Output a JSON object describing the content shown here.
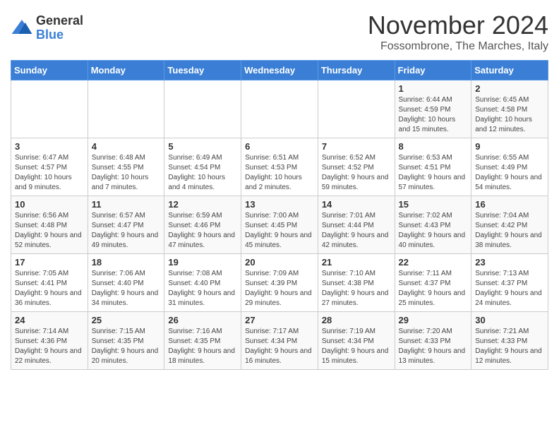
{
  "logo": {
    "general": "General",
    "blue": "Blue"
  },
  "title": "November 2024",
  "location": "Fossombrone, The Marches, Italy",
  "headers": [
    "Sunday",
    "Monday",
    "Tuesday",
    "Wednesday",
    "Thursday",
    "Friday",
    "Saturday"
  ],
  "rows": [
    [
      {
        "day": "",
        "info": ""
      },
      {
        "day": "",
        "info": ""
      },
      {
        "day": "",
        "info": ""
      },
      {
        "day": "",
        "info": ""
      },
      {
        "day": "",
        "info": ""
      },
      {
        "day": "1",
        "info": "Sunrise: 6:44 AM\nSunset: 4:59 PM\nDaylight: 10 hours and 15 minutes."
      },
      {
        "day": "2",
        "info": "Sunrise: 6:45 AM\nSunset: 4:58 PM\nDaylight: 10 hours and 12 minutes."
      }
    ],
    [
      {
        "day": "3",
        "info": "Sunrise: 6:47 AM\nSunset: 4:57 PM\nDaylight: 10 hours and 9 minutes."
      },
      {
        "day": "4",
        "info": "Sunrise: 6:48 AM\nSunset: 4:55 PM\nDaylight: 10 hours and 7 minutes."
      },
      {
        "day": "5",
        "info": "Sunrise: 6:49 AM\nSunset: 4:54 PM\nDaylight: 10 hours and 4 minutes."
      },
      {
        "day": "6",
        "info": "Sunrise: 6:51 AM\nSunset: 4:53 PM\nDaylight: 10 hours and 2 minutes."
      },
      {
        "day": "7",
        "info": "Sunrise: 6:52 AM\nSunset: 4:52 PM\nDaylight: 9 hours and 59 minutes."
      },
      {
        "day": "8",
        "info": "Sunrise: 6:53 AM\nSunset: 4:51 PM\nDaylight: 9 hours and 57 minutes."
      },
      {
        "day": "9",
        "info": "Sunrise: 6:55 AM\nSunset: 4:49 PM\nDaylight: 9 hours and 54 minutes."
      }
    ],
    [
      {
        "day": "10",
        "info": "Sunrise: 6:56 AM\nSunset: 4:48 PM\nDaylight: 9 hours and 52 minutes."
      },
      {
        "day": "11",
        "info": "Sunrise: 6:57 AM\nSunset: 4:47 PM\nDaylight: 9 hours and 49 minutes."
      },
      {
        "day": "12",
        "info": "Sunrise: 6:59 AM\nSunset: 4:46 PM\nDaylight: 9 hours and 47 minutes."
      },
      {
        "day": "13",
        "info": "Sunrise: 7:00 AM\nSunset: 4:45 PM\nDaylight: 9 hours and 45 minutes."
      },
      {
        "day": "14",
        "info": "Sunrise: 7:01 AM\nSunset: 4:44 PM\nDaylight: 9 hours and 42 minutes."
      },
      {
        "day": "15",
        "info": "Sunrise: 7:02 AM\nSunset: 4:43 PM\nDaylight: 9 hours and 40 minutes."
      },
      {
        "day": "16",
        "info": "Sunrise: 7:04 AM\nSunset: 4:42 PM\nDaylight: 9 hours and 38 minutes."
      }
    ],
    [
      {
        "day": "17",
        "info": "Sunrise: 7:05 AM\nSunset: 4:41 PM\nDaylight: 9 hours and 36 minutes."
      },
      {
        "day": "18",
        "info": "Sunrise: 7:06 AM\nSunset: 4:40 PM\nDaylight: 9 hours and 34 minutes."
      },
      {
        "day": "19",
        "info": "Sunrise: 7:08 AM\nSunset: 4:40 PM\nDaylight: 9 hours and 31 minutes."
      },
      {
        "day": "20",
        "info": "Sunrise: 7:09 AM\nSunset: 4:39 PM\nDaylight: 9 hours and 29 minutes."
      },
      {
        "day": "21",
        "info": "Sunrise: 7:10 AM\nSunset: 4:38 PM\nDaylight: 9 hours and 27 minutes."
      },
      {
        "day": "22",
        "info": "Sunrise: 7:11 AM\nSunset: 4:37 PM\nDaylight: 9 hours and 25 minutes."
      },
      {
        "day": "23",
        "info": "Sunrise: 7:13 AM\nSunset: 4:37 PM\nDaylight: 9 hours and 24 minutes."
      }
    ],
    [
      {
        "day": "24",
        "info": "Sunrise: 7:14 AM\nSunset: 4:36 PM\nDaylight: 9 hours and 22 minutes."
      },
      {
        "day": "25",
        "info": "Sunrise: 7:15 AM\nSunset: 4:35 PM\nDaylight: 9 hours and 20 minutes."
      },
      {
        "day": "26",
        "info": "Sunrise: 7:16 AM\nSunset: 4:35 PM\nDaylight: 9 hours and 18 minutes."
      },
      {
        "day": "27",
        "info": "Sunrise: 7:17 AM\nSunset: 4:34 PM\nDaylight: 9 hours and 16 minutes."
      },
      {
        "day": "28",
        "info": "Sunrise: 7:19 AM\nSunset: 4:34 PM\nDaylight: 9 hours and 15 minutes."
      },
      {
        "day": "29",
        "info": "Sunrise: 7:20 AM\nSunset: 4:33 PM\nDaylight: 9 hours and 13 minutes."
      },
      {
        "day": "30",
        "info": "Sunrise: 7:21 AM\nSunset: 4:33 PM\nDaylight: 9 hours and 12 minutes."
      }
    ]
  ]
}
